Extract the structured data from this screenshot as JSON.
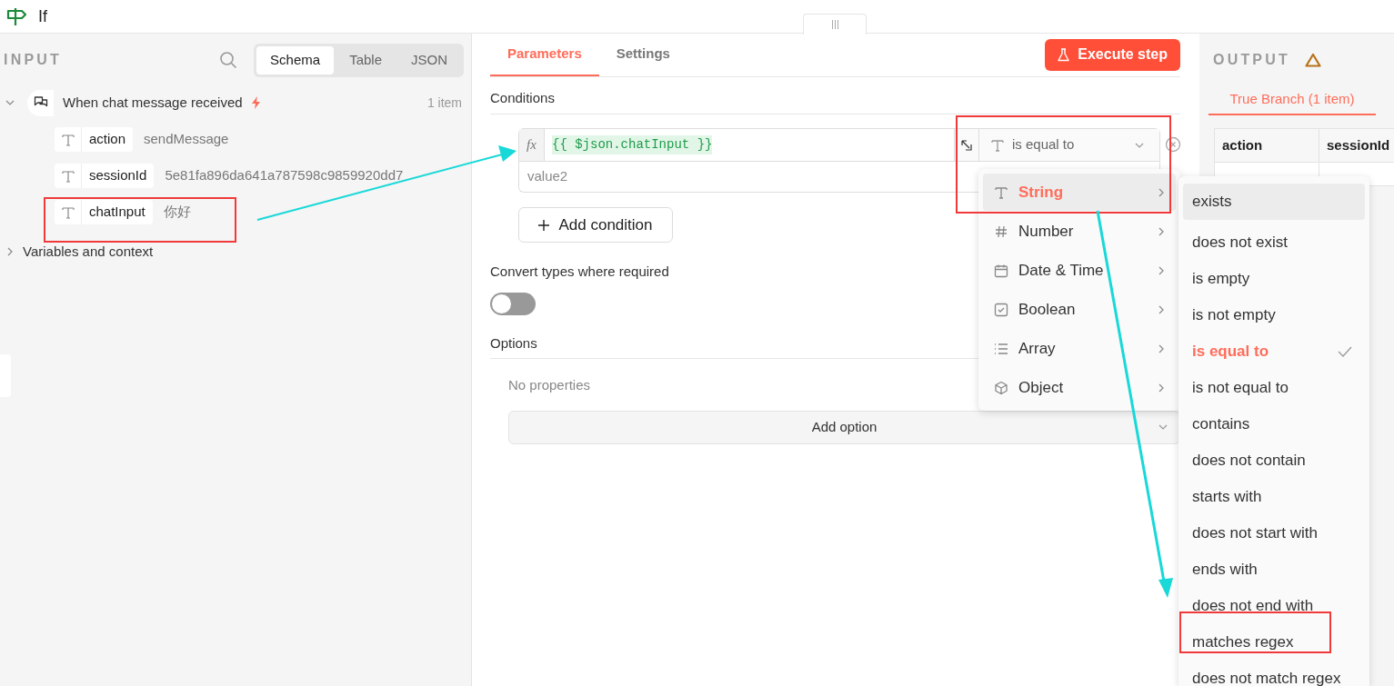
{
  "node": {
    "title": "If"
  },
  "input": {
    "label": "INPUT",
    "view_tabs": [
      {
        "label": "Schema",
        "selected": true
      },
      {
        "label": "Table",
        "selected": false
      },
      {
        "label": "JSON",
        "selected": false
      }
    ],
    "source": {
      "name": "When chat message received",
      "count": "1 item",
      "expanded": true,
      "fields": [
        {
          "name": "action",
          "value": "sendMessage"
        },
        {
          "name": "sessionId",
          "value": "5e81fa896da641a787598c9859920dd7"
        },
        {
          "name": "chatInput",
          "value": "你好"
        }
      ]
    },
    "variables": {
      "label": "Variables and context",
      "expanded": false
    }
  },
  "tabs": [
    {
      "label": "Parameters",
      "selected": true
    },
    {
      "label": "Settings",
      "selected": false
    }
  ],
  "execute_button": "Execute step",
  "conditions": {
    "label": "Conditions",
    "expression_prefix": "fx",
    "left_value": "{{ $json.chatInput }}",
    "right_placeholder": "value2",
    "operator": "is equal to",
    "add_button": "Add condition"
  },
  "convert_types": {
    "label": "Convert types where required",
    "on": false
  },
  "options": {
    "label": "Options",
    "empty_text": "No properties",
    "add_button": "Add option"
  },
  "type_menu": [
    {
      "label": "String",
      "kind": "text",
      "selected": true
    },
    {
      "label": "Number",
      "kind": "number",
      "selected": false
    },
    {
      "label": "Date & Time",
      "kind": "date",
      "selected": false
    },
    {
      "label": "Boolean",
      "kind": "boolean",
      "selected": false
    },
    {
      "label": "Array",
      "kind": "array",
      "selected": false
    },
    {
      "label": "Object",
      "kind": "object",
      "selected": false
    }
  ],
  "operator_menu": [
    {
      "label": "exists",
      "hovered": true,
      "selected": false
    },
    {
      "label": "does not exist",
      "hovered": false,
      "selected": false
    },
    {
      "label": "is empty",
      "hovered": false,
      "selected": false
    },
    {
      "label": "is not empty",
      "hovered": false,
      "selected": false
    },
    {
      "label": "is equal to",
      "hovered": false,
      "selected": true
    },
    {
      "label": "is not equal to",
      "hovered": false,
      "selected": false
    },
    {
      "label": "contains",
      "hovered": false,
      "selected": false
    },
    {
      "label": "does not contain",
      "hovered": false,
      "selected": false
    },
    {
      "label": "starts with",
      "hovered": false,
      "selected": false
    },
    {
      "label": "does not start with",
      "hovered": false,
      "selected": false
    },
    {
      "label": "ends with",
      "hovered": false,
      "selected": false
    },
    {
      "label": "does not end with",
      "hovered": false,
      "selected": false
    },
    {
      "label": "matches regex",
      "hovered": false,
      "selected": false
    },
    {
      "label": "does not match regex",
      "hovered": false,
      "selected": false
    }
  ],
  "output": {
    "label": "OUTPUT",
    "branch_tab": "True Branch (1 item)",
    "columns": [
      "action",
      "sessionId"
    ]
  }
}
